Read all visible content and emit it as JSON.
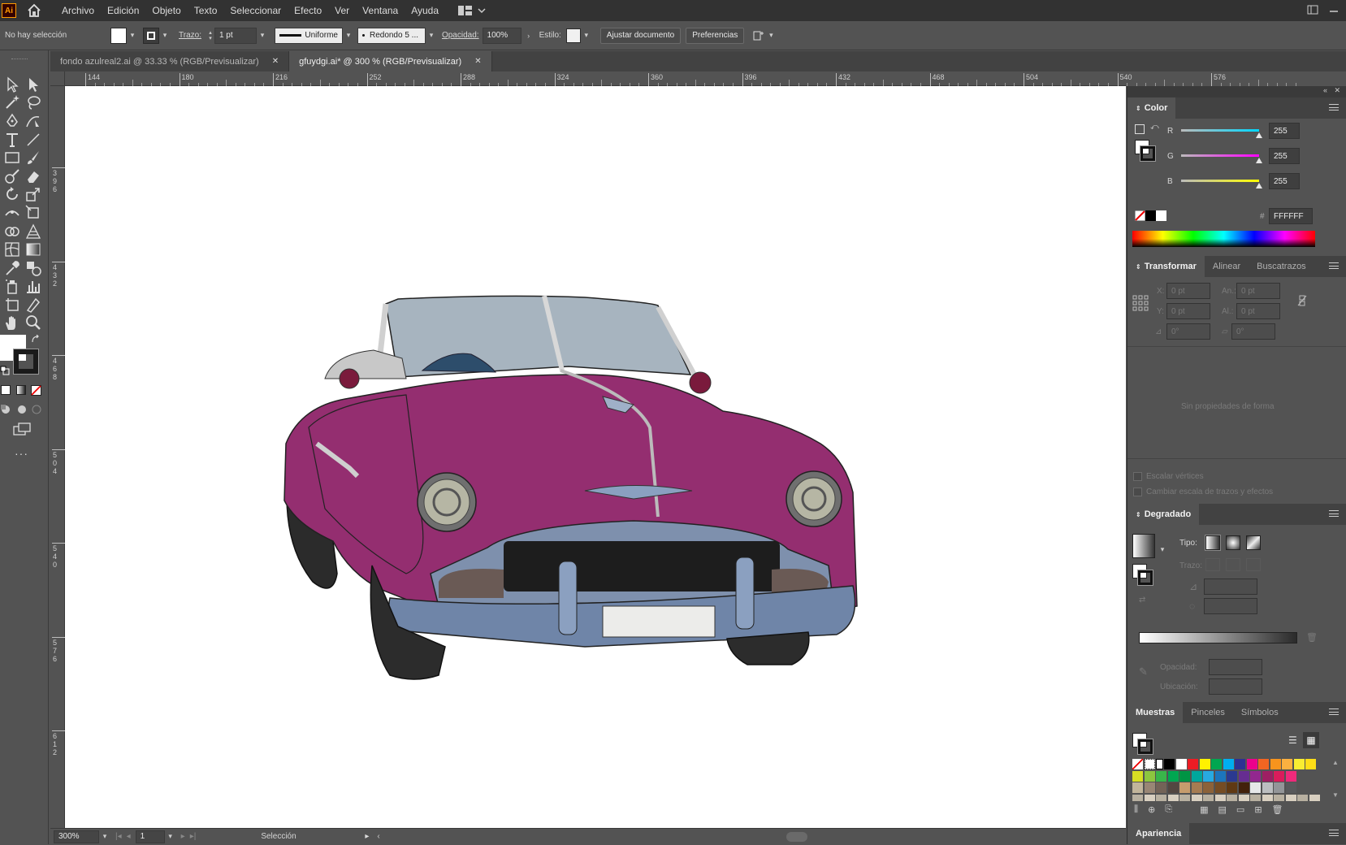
{
  "app": {
    "logo": "Ai",
    "menus": [
      "Archivo",
      "Edición",
      "Objeto",
      "Texto",
      "Seleccionar",
      "Efecto",
      "Ver",
      "Ventana",
      "Ayuda"
    ]
  },
  "control_bar": {
    "selection_status": "No hay selección",
    "stroke_label": "Trazo:",
    "stroke_weight": "1 pt",
    "stroke_profile": "Uniforme",
    "brush": "Redondo 5 ...",
    "opacity_label": "Opacidad:",
    "opacity_value": "100%",
    "style_label": "Estilo:",
    "fit_document_button": "Ajustar documento",
    "preferences_button": "Preferencias"
  },
  "tabs": [
    {
      "label": "fondo azulreal2.ai @ 33.33 % (RGB/Previsualizar)",
      "active": false
    },
    {
      "label": "gfuydgi.ai* @ 300 % (RGB/Previsualizar)",
      "active": true
    }
  ],
  "ruler": {
    "horizontal": [
      "144",
      "180",
      "216",
      "252",
      "288",
      "324",
      "360",
      "396",
      "432",
      "468",
      "504",
      "540",
      "576"
    ],
    "vertical": [
      [
        "3",
        "9",
        "6"
      ],
      [
        "4",
        "3",
        "2"
      ],
      [
        "4",
        "6",
        "8"
      ],
      [
        "5",
        "0",
        "4"
      ],
      [
        "5",
        "4",
        "0"
      ],
      [
        "5",
        "7",
        "6"
      ],
      [
        "6",
        "1",
        "2"
      ]
    ]
  },
  "status_bar": {
    "zoom": "300%",
    "artboard": "1",
    "mode": "Selección"
  },
  "color_panel": {
    "title": "Color",
    "channels": [
      {
        "label": "R",
        "value": "255",
        "color": "#00d8ff"
      },
      {
        "label": "G",
        "value": "255",
        "color": "#ff00ff"
      },
      {
        "label": "B",
        "value": "255",
        "color": "#ffff00"
      }
    ],
    "hex_prefix": "#",
    "hex": "FFFFFF"
  },
  "transform_panel": {
    "tabs": [
      "Transformar",
      "Alinear",
      "Buscatrazos"
    ],
    "x_label": "X:",
    "x_value": "0 pt",
    "y_label": "Y:",
    "y_value": "0 pt",
    "w_label": "An.:",
    "w_value": "0 pt",
    "h_label": "Al.:",
    "h_value": "0 pt",
    "angle_value": "0°",
    "shear_value": "0°",
    "no_shape": "Sin propiedades de forma",
    "scale_corners": "Escalar vértices",
    "scale_strokes": "Cambiar escala de trazos y efectos"
  },
  "gradient_panel": {
    "title": "Degradado",
    "type_label": "Tipo:",
    "stroke_label": "Trazo:",
    "opacity_label": "Opacidad:",
    "location_label": "Ubicación:"
  },
  "swatches_panel": {
    "tabs": [
      "Muestras",
      "Pinceles",
      "Símbolos"
    ],
    "row1": [
      "#000000",
      "#ffffff",
      "#ee1c24",
      "#fff200",
      "#00a650",
      "#00aeef",
      "#2e3192",
      "#ec008c",
      "#f26522",
      "#f7941d",
      "#fbb040",
      "#f9ed32",
      "#ffde17"
    ],
    "row2": [
      "#d7df23",
      "#8dc63f",
      "#39b54a",
      "#00a651",
      "#009444",
      "#00a79d",
      "#27aae1",
      "#1c75bc",
      "#2b3990",
      "#662d91",
      "#92278f",
      "#9e1f63",
      "#da1c5c",
      "#ee2a7b"
    ],
    "row3": [
      "#c2b59b",
      "#998675",
      "#736357",
      "#534741",
      "#c69c6d",
      "#a67c52",
      "#8c6239",
      "#754c24",
      "#603913",
      "#42210b",
      "#e6e7e8",
      "#bcbec0",
      "#939598",
      "#58595b"
    ]
  },
  "appearance_panel": {
    "title": "Apariencia"
  }
}
